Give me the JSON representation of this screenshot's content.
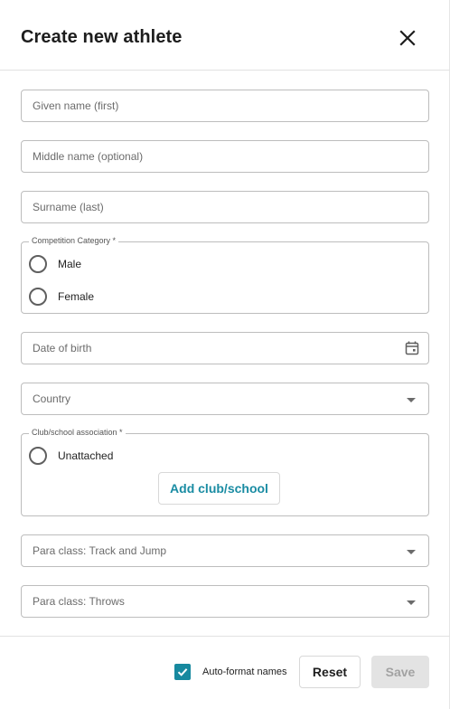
{
  "dialog": {
    "title": "Create new athlete"
  },
  "form": {
    "given_name_placeholder": "Given name (first)",
    "middle_name_placeholder": "Middle name (optional)",
    "surname_placeholder": "Surname (last)",
    "competition_category": {
      "legend": "Competition Category *",
      "options": [
        "Male",
        "Female"
      ]
    },
    "dob_placeholder": "Date of birth",
    "country_placeholder": "Country",
    "club": {
      "legend": "Club/school association *",
      "unattached_label": "Unattached",
      "add_button_label": "Add club/school"
    },
    "para_track_placeholder": "Para class: Track and Jump",
    "para_throws_placeholder": "Para class: Throws"
  },
  "footer": {
    "auto_format_label": "Auto-format names",
    "auto_format_checked": true,
    "reset_label": "Reset",
    "save_label": "Save",
    "save_disabled": true
  },
  "colors": {
    "accent": "#17899f",
    "border": "#bdbdbd",
    "disabled_bg": "#e3e3e3"
  },
  "icons": {
    "close": "close-icon",
    "calendar": "calendar-icon",
    "dropdown": "chevron-down-icon",
    "check": "check-icon"
  }
}
